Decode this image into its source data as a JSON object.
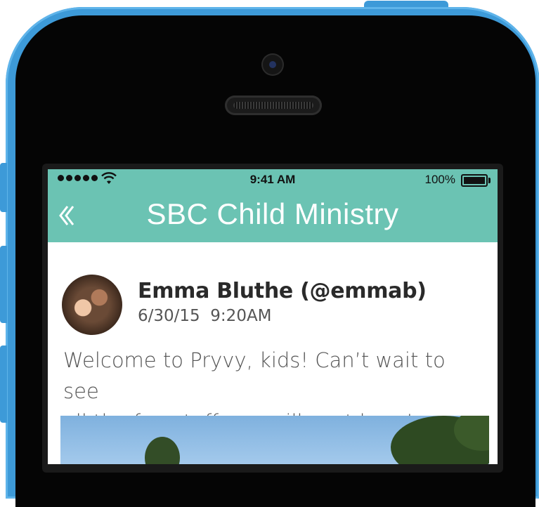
{
  "status_bar": {
    "time": "9:41 AM",
    "battery": "100%"
  },
  "nav": {
    "title": "SBC Child Ministry",
    "back_icon": "chevron-left-icon"
  },
  "post": {
    "author": "Emma Bluthe (@emmab)",
    "date": "6/30/15",
    "time": "9:20AM",
    "message_line1": "Welcome to Pryvy, kids!  Can’t wait to see",
    "message_line2": "all the fun stuff you will post here!"
  },
  "colors": {
    "header": "#6bc3b3",
    "phone_shell": "#3d9ad8"
  }
}
